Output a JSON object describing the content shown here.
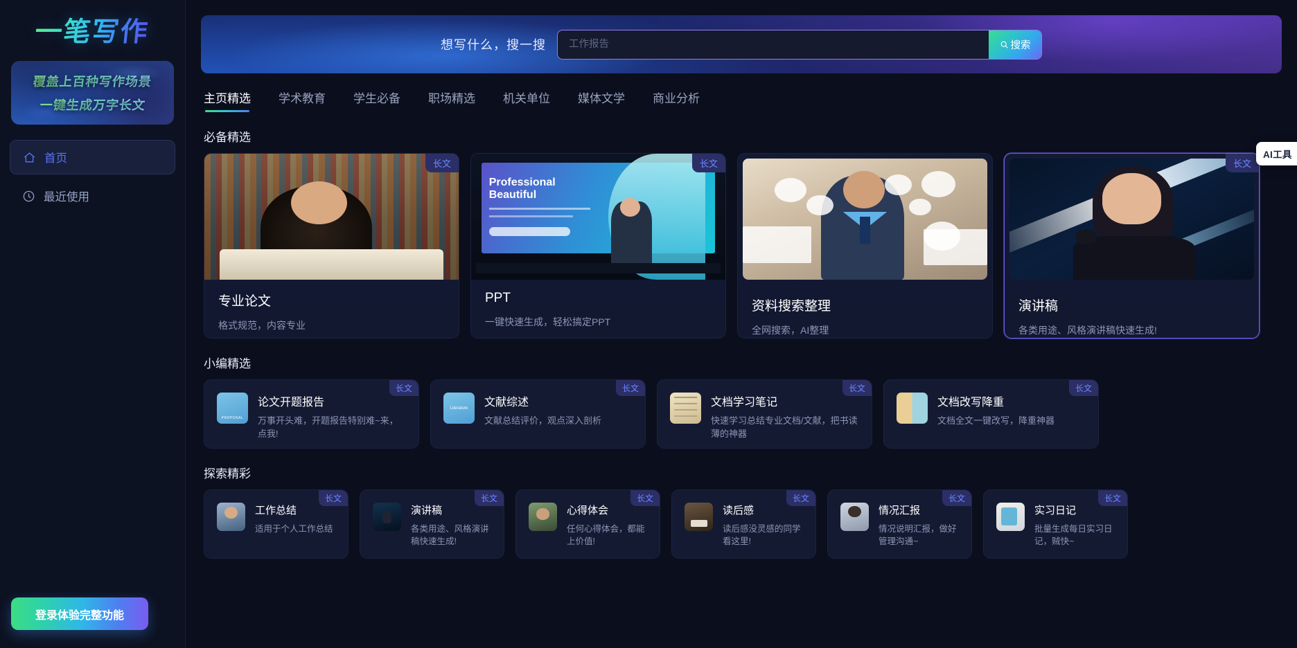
{
  "app": {
    "logo_text": "一笔写作",
    "promo": {
      "line1": "覆盖上百种写作场景",
      "line2": "一键生成万字长文"
    },
    "nav_items": [
      {
        "label": "首页",
        "icon": "home-icon",
        "active": true
      },
      {
        "label": "最近使用",
        "icon": "clock-icon",
        "active": false
      }
    ],
    "login_button": "登录体验完整功能"
  },
  "search": {
    "label": "想写什么，搜一搜",
    "placeholder": "工作报告",
    "value": "",
    "button": "搜索"
  },
  "tabs": [
    {
      "label": "主页精选",
      "active": true
    },
    {
      "label": "学术教育",
      "active": false
    },
    {
      "label": "学生必备",
      "active": false
    },
    {
      "label": "职场精选",
      "active": false
    },
    {
      "label": "机关单位",
      "active": false
    },
    {
      "label": "媒体文学",
      "active": false
    },
    {
      "label": "商业分析",
      "active": false
    }
  ],
  "ai_toolbar": {
    "label": "AI工具",
    "icons": [
      "hd-badge-icon",
      "magic-wand-icon",
      "eraser-icon",
      "image-edit-icon",
      "crop-icon",
      "download-icon",
      "settings-icon"
    ]
  },
  "sections": [
    {
      "title": "必备精选",
      "cards": [
        {
          "title": "专业论文",
          "desc": "格式规范，内容专业",
          "badge": "长文",
          "selected": false
        },
        {
          "title": "PPT",
          "desc": "一键快速生成，轻松搞定PPT",
          "badge": "长文",
          "selected": false
        },
        {
          "title": "资料搜索整理",
          "desc": "全网搜索，AI整理",
          "badge": "",
          "selected": false
        },
        {
          "title": "演讲稿",
          "desc": "各类用途、风格演讲稿快速生成!",
          "badge": "长文",
          "selected": true
        }
      ]
    },
    {
      "title": "小编精选",
      "cards": [
        {
          "title": "论文开题报告",
          "desc": "万事开头难，开题报告特别难~来，点我!",
          "badge": "长文"
        },
        {
          "title": "文献综述",
          "desc": "文献总结评价，观点深入剖析",
          "badge": "长文"
        },
        {
          "title": "文档学习笔记",
          "desc": "快速学习总结专业文档/文献，把书读薄的神器",
          "badge": "长文"
        },
        {
          "title": "文档改写降重",
          "desc": "文档全文一键改写，降重神器",
          "badge": "长文"
        }
      ]
    },
    {
      "title": "探索精彩",
      "cards": [
        {
          "title": "工作总结",
          "desc": "适用于个人工作总结",
          "badge": "长文"
        },
        {
          "title": "演讲稿",
          "desc": "各类用途、风格演讲稿快速生成!",
          "badge": "长文"
        },
        {
          "title": "心得体会",
          "desc": "任何心得体会，都能上价值!",
          "badge": "长文"
        },
        {
          "title": "读后感",
          "desc": "读后感没灵感的同学看这里!",
          "badge": "长文"
        },
        {
          "title": "情况汇报",
          "desc": "情况说明汇报，做好管理沟通~",
          "badge": "长文"
        },
        {
          "title": "实习日记",
          "desc": "批量生成每日实习日记，贼快~",
          "badge": "长文"
        }
      ]
    }
  ],
  "ppt_thumb": {
    "title_line1": "Professional",
    "title_line2": "Beautiful"
  },
  "icon_labels": {
    "proposal": "PROPOSAL",
    "literature": "Literature"
  },
  "colors": {
    "accent_green": "#3ddc84",
    "accent_blue": "#4f7ef0",
    "accent_purple": "#7a5cf0",
    "badge_bg": "#2b2f66",
    "badge_text": "#6e86ff",
    "page_bg": "#0b0f1d"
  }
}
